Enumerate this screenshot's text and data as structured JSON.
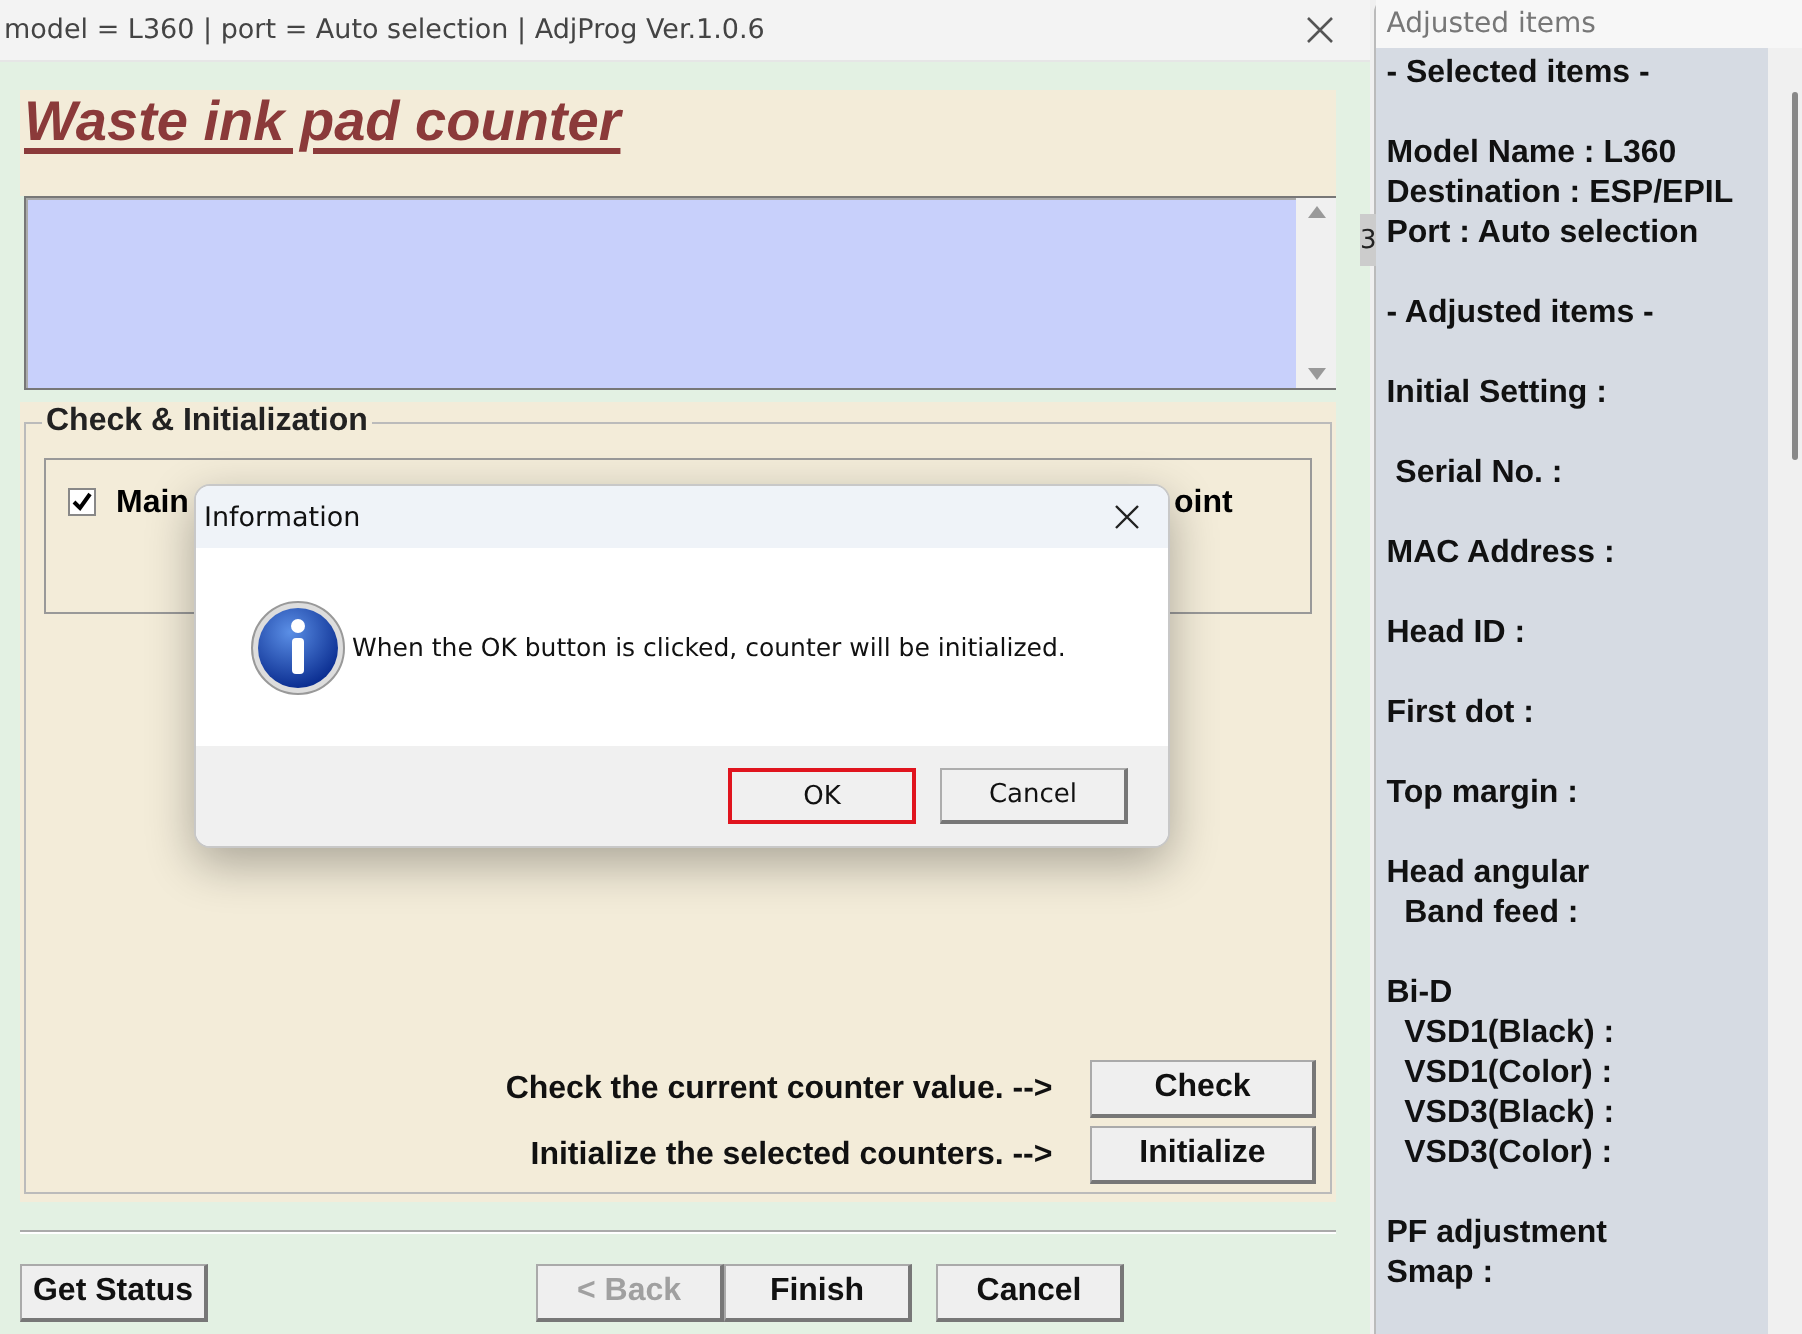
{
  "main_window": {
    "title": "model = L360 | port = Auto selection | AdjProg Ver.1.0.6",
    "heading": "Waste ink pad counter",
    "group_title": "Check & Initialization",
    "counter_row": {
      "checked": true,
      "label": "Main",
      "label_end": "oint"
    },
    "actions": [
      {
        "text": "Check the current counter value. -->",
        "button": "Check"
      },
      {
        "text": "Initialize the selected counters. -->",
        "button": "Initialize"
      }
    ],
    "buttons": [
      {
        "label": "Get Status",
        "disabled": false
      },
      {
        "label": "< Back",
        "disabled": true
      },
      {
        "label": "Finish",
        "disabled": false
      },
      {
        "label": "Cancel",
        "disabled": false
      }
    ]
  },
  "dialog": {
    "title": "Information",
    "message": "When the OK button is clicked, counter will be initialized.",
    "buttons": [
      {
        "label": "OK",
        "focused": true
      },
      {
        "label": "Cancel",
        "focused": false
      }
    ]
  },
  "side_window": {
    "title": "Adjusted items",
    "fragment": "3",
    "sections": [
      [
        "- Selected items -"
      ],
      [
        "Model Name : L360",
        "Destination : ESP/EPIL",
        "Port : Auto selection"
      ],
      [
        "- Adjusted items -"
      ],
      [
        "Initial Setting :"
      ],
      [
        " Serial No. :"
      ],
      [
        "MAC Address :"
      ],
      [
        "Head ID :"
      ],
      [
        "First dot :"
      ],
      [
        "Top margin :"
      ],
      [
        "Head angular",
        "  Band feed :"
      ],
      [
        "Bi-D",
        "  VSD1(Black) :",
        "  VSD1(Color) :",
        "  VSD3(Black) :",
        "  VSD3(Color) :"
      ],
      [
        "PF adjustment",
        "Smap :"
      ]
    ]
  }
}
